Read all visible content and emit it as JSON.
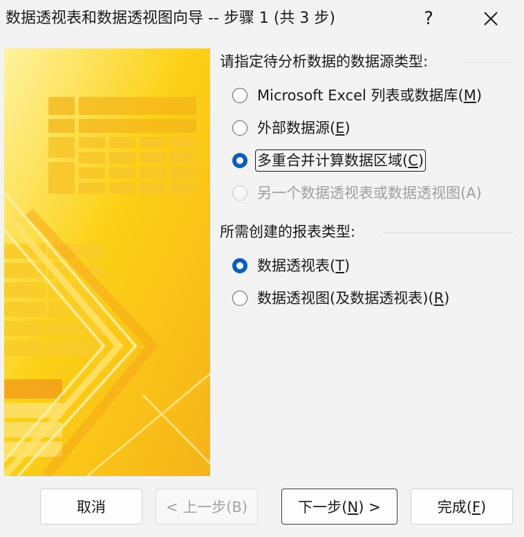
{
  "window": {
    "title": "数据透视表和数据透视图向导 -- 步骤 1 (共 3 步)",
    "help_label": "?",
    "close_icon": "close-icon"
  },
  "data_source_group": {
    "label": "请指定待分析数据的数据源类型:",
    "options": [
      {
        "text": "Microsoft Excel 列表或数据库(",
        "key": "M",
        "suffix": ")",
        "checked": false,
        "enabled": true
      },
      {
        "text": "外部数据源(",
        "key": "E",
        "suffix": ")",
        "checked": false,
        "enabled": true
      },
      {
        "text": "多重合并计算数据区域(",
        "key": "C",
        "suffix": ")",
        "checked": true,
        "enabled": true
      },
      {
        "text": "另一个数据透视表或数据透视图(A)",
        "key": "",
        "suffix": "",
        "checked": false,
        "enabled": false
      }
    ]
  },
  "report_type_group": {
    "label": "所需创建的报表类型:",
    "options": [
      {
        "text": "数据透视表(",
        "key": "T",
        "suffix": ")",
        "checked": true,
        "enabled": true
      },
      {
        "text": "数据透视图(及数据透视表)(",
        "key": "R",
        "suffix": ")",
        "checked": false,
        "enabled": true
      }
    ]
  },
  "buttons": {
    "cancel": "取消",
    "back": "< 上一步(B)",
    "next_text": "下一步(",
    "next_key": "N",
    "next_suffix": ") >",
    "finish_text": "完成(",
    "finish_key": "F",
    "finish_suffix": ")"
  },
  "colors": {
    "accent": "#0a5fb4",
    "art_yellow": "#fcd116",
    "art_orange": "#f7b418"
  }
}
